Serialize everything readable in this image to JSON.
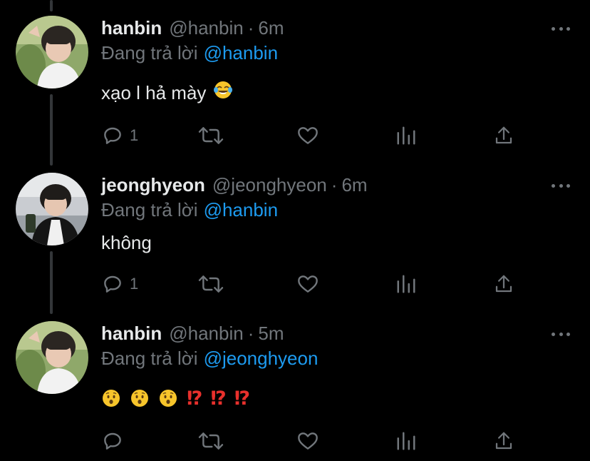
{
  "thread": {
    "tweets": [
      {
        "name": "hanbin",
        "handle": "@hanbin",
        "separator": "·",
        "time": "6m",
        "reply_prefix": "Đang trả lời",
        "reply_to": "@hanbin",
        "text": "xạo l hả mày",
        "reply_count": "1",
        "avatar_icon": "avatar-photo"
      },
      {
        "name": "jeonghyeon",
        "handle": "@jeonghyeon",
        "separator": "·",
        "time": "6m",
        "reply_prefix": "Đang trả lời",
        "reply_to": "@hanbin",
        "text": "không",
        "reply_count": "1",
        "avatar_icon": "avatar-photo"
      },
      {
        "name": "hanbin",
        "handle": "@hanbin",
        "separator": "·",
        "time": "5m",
        "reply_prefix": "Đang trả lời",
        "reply_to": "@jeonghyeon",
        "text": "",
        "reply_count": "",
        "avatar_icon": "avatar-photo"
      }
    ],
    "tweet_3_emojis": [
      "hushed-face",
      "hushed-face",
      "hushed-face",
      "⁉",
      "⁉",
      "⁉"
    ]
  },
  "colors": {
    "background": "#000000",
    "primary_text": "#e7e9ea",
    "secondary_text": "#71767b",
    "link": "#1d9bf0",
    "thread_line": "#333639",
    "exclamation": "#e8302c"
  },
  "icons": {
    "reply": "reply-icon",
    "retweet": "retweet-icon",
    "like": "heart-icon",
    "analytics": "analytics-icon",
    "share": "share-icon",
    "more": "more-icon"
  }
}
